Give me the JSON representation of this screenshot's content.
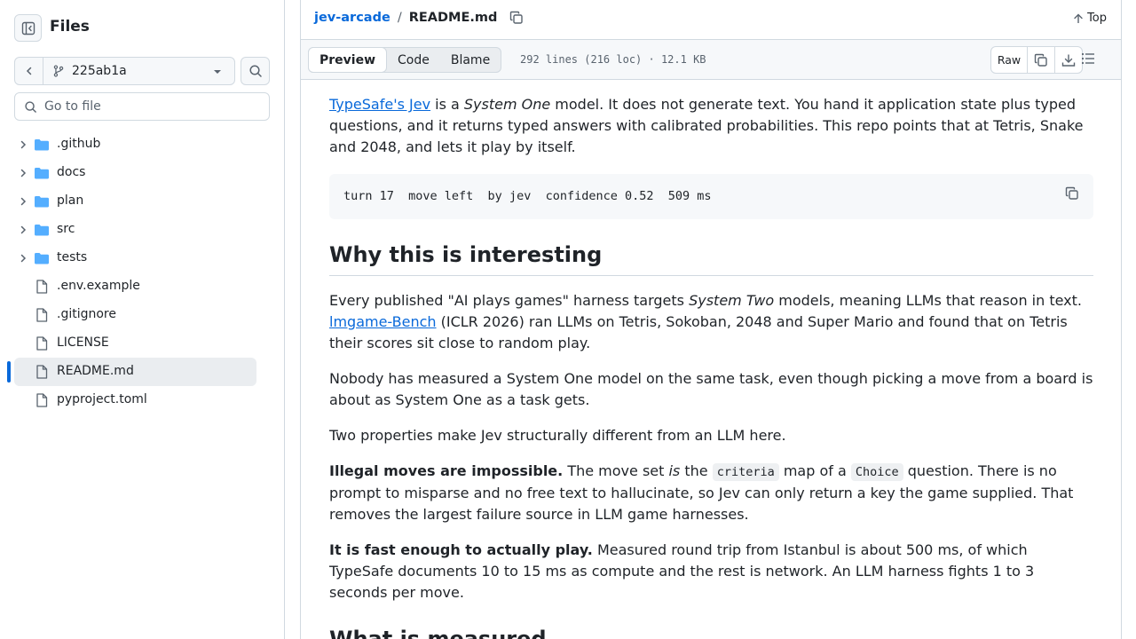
{
  "sidebar": {
    "title": "Files",
    "branch": "225ab1a",
    "search_placeholder": "Go to file",
    "tree": [
      {
        "name": ".github",
        "type": "folder"
      },
      {
        "name": "docs",
        "type": "folder"
      },
      {
        "name": "plan",
        "type": "folder"
      },
      {
        "name": "src",
        "type": "folder"
      },
      {
        "name": "tests",
        "type": "folder"
      },
      {
        "name": ".env.example",
        "type": "file"
      },
      {
        "name": ".gitignore",
        "type": "file"
      },
      {
        "name": "LICENSE",
        "type": "file"
      },
      {
        "name": "README.md",
        "type": "file",
        "selected": true
      },
      {
        "name": "pyproject.toml",
        "type": "file"
      }
    ]
  },
  "header": {
    "repo": "jev-arcade",
    "separator": "/",
    "file": "README.md",
    "top_label": "Top"
  },
  "filebar": {
    "tabs": [
      "Preview",
      "Code",
      "Blame"
    ],
    "active_tab": "Preview",
    "meta": "292 lines (216 loc) · 12.1 KB",
    "raw_label": "Raw"
  },
  "content": {
    "intro": {
      "link": "TypeSafe's Jev",
      "t1": " is a ",
      "em": "System One",
      "t2": " model. It does not generate text. You hand it application state plus typed questions, and it returns typed answers with calibrated probabilities. This repo points that at Tetris, Snake and 2048, and lets it play by itself."
    },
    "code_line": "turn 17  move left  by jev  confidence 0.52  509 ms",
    "h2_interesting": "Why this is interesting",
    "p1": {
      "t1": "Every published \"AI plays games\" harness targets ",
      "em": "System Two",
      "t2": " models, meaning LLMs that reason in text. ",
      "link": "lmgame-Bench",
      "t3": " (ICLR 2026) ran LLMs on Tetris, Sokoban, 2048 and Super Mario and found that on Tetris their scores sit close to random play."
    },
    "p2": "Nobody has measured a System One model on the same task, even though picking a move from a board is about as System One as a task gets.",
    "p3": "Two properties make Jev structurally different from an LLM here.",
    "p4": {
      "strong": "Illegal moves are impossible.",
      "t1": " The move set ",
      "em": "is",
      "t2": " the ",
      "code1": "criteria",
      "t3": " map of a ",
      "code2": "Choice",
      "t4": " question. There is no prompt to misparse and no free text to hallucinate, so Jev can only return a key the game supplied. That removes the largest failure source in LLM game harnesses."
    },
    "p5": {
      "strong": "It is fast enough to actually play.",
      "t1": " Measured round trip from Istanbul is about 500 ms, of which TypeSafe documents 10 to 15 ms as compute and the rest is network. An LLM harness fights 1 to 3 seconds per move."
    },
    "h2_measured": "What is measured"
  },
  "colors": {
    "accent": "#0969da",
    "border": "#d1d9e0",
    "folder": "#54aeff"
  }
}
